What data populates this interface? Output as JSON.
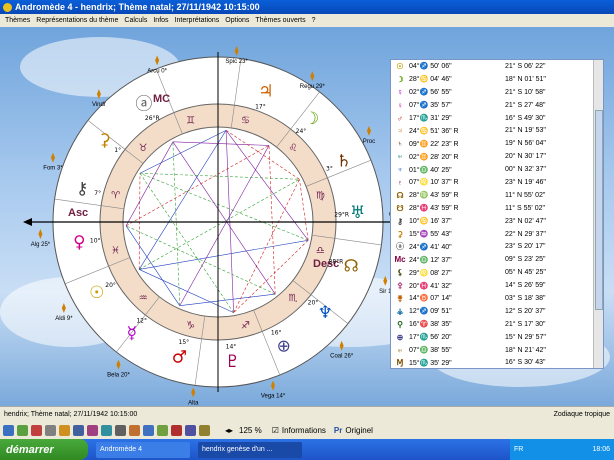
{
  "window": {
    "title": "Andromède 4 - hendrix; Thème natal; 27/11/1942 10:15:00"
  },
  "menu": [
    "Thèmes",
    "Représentations du thème",
    "Calculs",
    "Infos",
    "Interprétations",
    "Options",
    "Thèmes ouverts",
    "?"
  ],
  "chart_labels": {
    "asc": "Asc",
    "mc": "MC",
    "fc": "FC",
    "desc": "Desc",
    "points": [
      "Arcu 0*",
      "Spic 23*",
      "Regu 29*",
      "Proc",
      "Cast",
      "Sir 1",
      "Coal 26*",
      "Vega 14*",
      "Alta",
      "Bela 20*",
      "Aldi 9*",
      "Alg 25*",
      "Fom 3*",
      "Vindr"
    ],
    "degrees": [
      "17°",
      "24°",
      "3°",
      "29°R",
      "28°R",
      "20°",
      "16°",
      "14°",
      "15°",
      "12°",
      "20°",
      "10°",
      "7°",
      "1°",
      "26°R"
    ],
    "houses": [
      "I",
      "II",
      "III",
      "IV",
      "V",
      "VI",
      "VII",
      "VIII",
      "IX",
      "X",
      "XI",
      "XII"
    ]
  },
  "planets_table": [
    {
      "glyph": "☉",
      "color": "#c8a000",
      "pos": "04°♐ 50' 06\"",
      "decl": "21° S 06' 22\""
    },
    {
      "glyph": "☽",
      "color": "#5aa000",
      "pos": "28°♋ 04' 46\"",
      "decl": "18° N 01' 51\""
    },
    {
      "glyph": "☿",
      "color": "#b000c8",
      "pos": "02°♐ 56' 55\"",
      "decl": "21° S 10' 58\""
    },
    {
      "glyph": "♀",
      "color": "#d0008a",
      "pos": "07°♐ 35' 57\"",
      "decl": "21° S 27' 48\""
    },
    {
      "glyph": "♂",
      "color": "#c80000",
      "pos": "17°♏ 31' 29\"",
      "decl": "16° S 49' 30\""
    },
    {
      "glyph": "♃",
      "color": "#d06000",
      "pos": "24°♋ 51' 36\" R",
      "decl": "21° N 19' 53\""
    },
    {
      "glyph": "♄",
      "color": "#703000",
      "pos": "09°♊ 22' 23\" R",
      "decl": "19° N 56' 04\""
    },
    {
      "glyph": "♅",
      "color": "#007878",
      "pos": "02°♊ 28' 20\" R",
      "decl": "20° N 30' 17\""
    },
    {
      "glyph": "♆",
      "color": "#0050c0",
      "pos": "01°♎ 40' 25\"",
      "decl": "00° N 32' 37\""
    },
    {
      "glyph": "♇",
      "color": "#a00050",
      "pos": "07°♌ 10' 37\" R",
      "decl": "23° N 19' 46\""
    },
    {
      "glyph": "☊",
      "color": "#906000",
      "pos": "28°♍ 43' 59\" R",
      "decl": "11° N 55' 02\""
    },
    {
      "glyph": "☋",
      "color": "#906000",
      "pos": "28°♓ 43' 59\" R",
      "decl": "11° S 55' 02\""
    },
    {
      "glyph": "⚷",
      "color": "#404040",
      "pos": "10°♋ 16' 37\"",
      "decl": "23° N 02' 47\""
    },
    {
      "glyph": "⚳",
      "color": "#c08000",
      "pos": "15°♒ 55' 43\"",
      "decl": "22° N 29' 37\""
    },
    {
      "glyph": "ⓐ",
      "color": "#606060",
      "pos": "24°♐ 41' 40\"",
      "decl": "23° S 20' 17\""
    },
    {
      "glyph": "Mc",
      "color": "#800040",
      "pos": "24°♎ 12' 37\"",
      "decl": "09° S 23' 25\""
    },
    {
      "glyph": "⚸",
      "color": "#404000",
      "pos": "29°♌ 08' 27\"",
      "decl": "05° N 45' 25\""
    },
    {
      "glyph": "⚴",
      "color": "#b04080",
      "pos": "20°♓ 41' 32\"",
      "decl": "14° S 26' 59\""
    },
    {
      "glyph": "⚵",
      "color": "#c06000",
      "pos": "14°♉ 07' 14\"",
      "decl": "03° S 18' 38\""
    },
    {
      "glyph": "⚶",
      "color": "#0060a0",
      "pos": "12°♐ 09' 51\"",
      "decl": "12° S 20' 37\""
    },
    {
      "glyph": "⚲",
      "color": "#206020",
      "pos": "16°♈ 38' 35\"",
      "decl": "21° S 17' 30\""
    },
    {
      "glyph": "⊕",
      "color": "#404090",
      "pos": "17°♏ 56' 20\"",
      "decl": "15° N 29' 57\""
    },
    {
      "glyph": "♅",
      "color": "#906000",
      "pos": "07°♎ 38' 55\"",
      "decl": "18° N 21' 42\""
    },
    {
      "glyph": "Ɱ",
      "color": "#805000",
      "pos": "15°♏ 35' 29\"",
      "decl": "16° S 30' 43\""
    }
  ],
  "status": {
    "left": "hendrix; Thème natal; 27/11/1942 10:15:00",
    "right": "Zodiaque tropique"
  },
  "toolbar": {
    "zoom": "125 %",
    "informations": "Informations",
    "original": "Originel"
  },
  "taskbar": {
    "start": "démarrer",
    "tasks": [
      "Andromède 4",
      "hendrix genèse d'un ..."
    ],
    "lang": "FR",
    "time": "18:06"
  }
}
